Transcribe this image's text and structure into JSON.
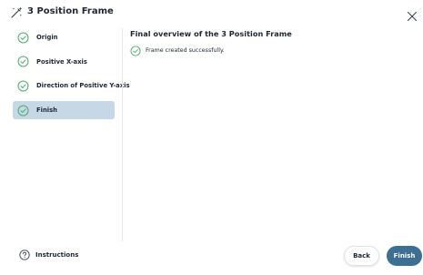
{
  "dialog": {
    "title": "3 Position Frame",
    "title_icon": "wand-icon",
    "close_icon": "close-icon"
  },
  "steps": [
    {
      "label": "Origin",
      "complete": true,
      "active": false
    },
    {
      "label": "Positive X-axis",
      "complete": true,
      "active": false
    },
    {
      "label": "Direction of Positive Y-axis",
      "complete": true,
      "active": false
    },
    {
      "label": "Finish",
      "complete": true,
      "active": true
    }
  ],
  "content": {
    "title": "Final overview of the 3 Position Frame",
    "status_message": "Frame created successfully.",
    "status_icon": "check-circle-icon"
  },
  "footer": {
    "instructions_label": "Instructions",
    "instructions_icon": "help-icon",
    "back_label": "Back",
    "finish_label": "Finish"
  },
  "colors": {
    "accent": "#3d6f95",
    "success": "#4cae6d",
    "active_step_bg": "#c6d7e6",
    "text": "#1d2733"
  }
}
